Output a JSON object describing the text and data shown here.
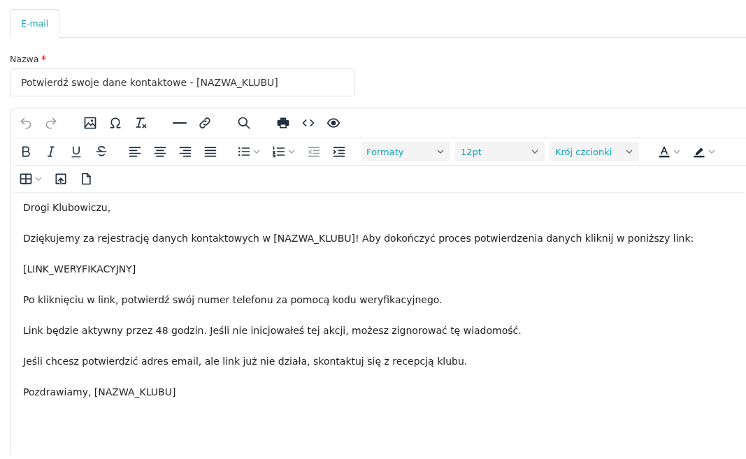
{
  "tabs": [
    {
      "label": "E-mail",
      "selected": true
    }
  ],
  "name_field": {
    "label": "Nazwa",
    "required": true,
    "value": "Potwierdź swoje dane kontaktowe - [NAZWA_KLUBU]"
  },
  "toolbar": {
    "rows": [
      {
        "groups": [
          [
            {
              "kind": "undo",
              "disabled": true
            },
            {
              "kind": "redo",
              "disabled": true
            }
          ],
          [
            {
              "kind": "image",
              "disabled": false
            },
            {
              "kind": "omega",
              "disabled": false
            },
            {
              "kind": "clearformat",
              "disabled": false
            }
          ],
          [
            {
              "kind": "hr",
              "disabled": false
            },
            {
              "kind": "link",
              "disabled": false
            }
          ],
          [
            {
              "kind": "search",
              "disabled": false
            }
          ],
          [
            {
              "kind": "print",
              "disabled": false
            },
            {
              "kind": "code",
              "disabled": false
            },
            {
              "kind": "eye",
              "disabled": false
            }
          ]
        ]
      },
      {
        "groups": [
          [
            {
              "kind": "bold",
              "disabled": false
            },
            {
              "kind": "italic",
              "disabled": false
            },
            {
              "kind": "underline",
              "disabled": false
            },
            {
              "kind": "strike",
              "disabled": false
            }
          ],
          [
            {
              "kind": "alignleft",
              "disabled": false
            },
            {
              "kind": "aligncenter",
              "disabled": false
            },
            {
              "kind": "alignright",
              "disabled": false
            },
            {
              "kind": "justify",
              "disabled": false
            }
          ],
          [
            {
              "kind": "bullets",
              "disabled": false,
              "menu": true
            },
            {
              "kind": "numbers",
              "disabled": false,
              "menu": true
            },
            {
              "kind": "outdent",
              "disabled": true
            },
            {
              "kind": "indent",
              "disabled": false
            }
          ],
          [
            {
              "kind": "select",
              "value": "Formaty"
            },
            {
              "kind": "select",
              "value": "12pt"
            },
            {
              "kind": "select",
              "value": "Krój czcionki"
            }
          ],
          [
            {
              "kind": "textcolor",
              "disabled": false,
              "menu": true
            },
            {
              "kind": "highlight",
              "disabled": false,
              "menu": true
            }
          ]
        ]
      },
      {
        "groups": [
          [
            {
              "kind": "table",
              "disabled": false,
              "menu": true
            },
            {
              "kind": "upload",
              "disabled": false
            },
            {
              "kind": "page",
              "disabled": false
            }
          ]
        ]
      }
    ]
  },
  "content": [
    "Drogi Klubowiczu,",
    "Dziękujemy za rejestrację danych kontaktowych w [NAZWA_KLUBU]! Aby dokończyć proces potwierdzenia danych kliknij w poniższy link:",
    "[LINK_WERYFIKACYJNY]",
    "Po kliknięciu w link, potwierdź swój numer telefonu za pomocą kodu weryfikacyjnego.",
    "Link będzie aktywny przez 48 godzin. Jeśli nie inicjowałeś tej akcji, możesz zignorować tę wiadomość.",
    "Jeśli chcesz potwierdzić adres email, ale link już nie działa, skontaktuj się z recepcją klubu.",
    "Pozdrawiamy, [NAZWA_KLUBU]"
  ]
}
